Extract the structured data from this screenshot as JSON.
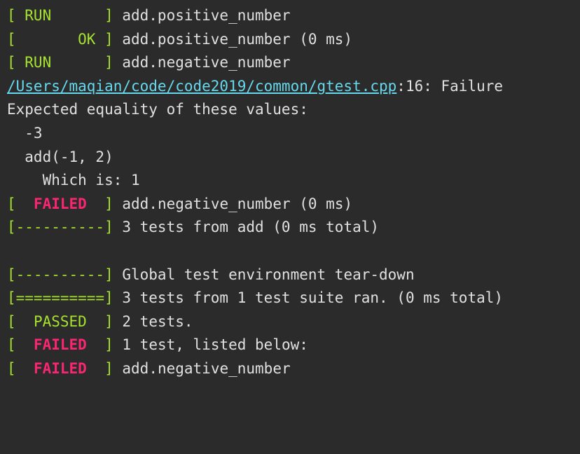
{
  "lines": {
    "l1_status": "[ RUN      ]",
    "l1_text": " add.positive_number",
    "l2_status": "[       OK ]",
    "l2_text": " add.positive_number (0 ms)",
    "l3_status": "[ RUN      ]",
    "l3_text": " add.negative_number",
    "l4_link": "/Users/maqian/code/code2019/common/gtest.cpp",
    "l4_text": ":16: Failure",
    "l5": "Expected equality of these values:",
    "l6": "  -3",
    "l7": "  add(-1, 2)",
    "l8": "    Which is: 1",
    "l9_open": "[",
    "l9_status": "  FAILED  ",
    "l9_close": "]",
    "l9_text": " add.negative_number (0 ms)",
    "l10_status": "[----------]",
    "l10_text": " 3 tests from add (0 ms total)",
    "blank": " ",
    "l11_status": "[----------]",
    "l11_text": " Global test environment tear-down",
    "l12_status": "[==========]",
    "l12_text": " 3 tests from 1 test suite ran. (0 ms total)",
    "l13_open": "[",
    "l13_status": "  PASSED  ",
    "l13_close": "]",
    "l13_text": " 2 tests.",
    "l14_open": "[",
    "l14_status": "  FAILED  ",
    "l14_close": "]",
    "l14_text": " 1 test, listed below:",
    "l15_open": "[",
    "l15_status": "  FAILED  ",
    "l15_close": "]",
    "l15_text": " add.negative_number"
  }
}
